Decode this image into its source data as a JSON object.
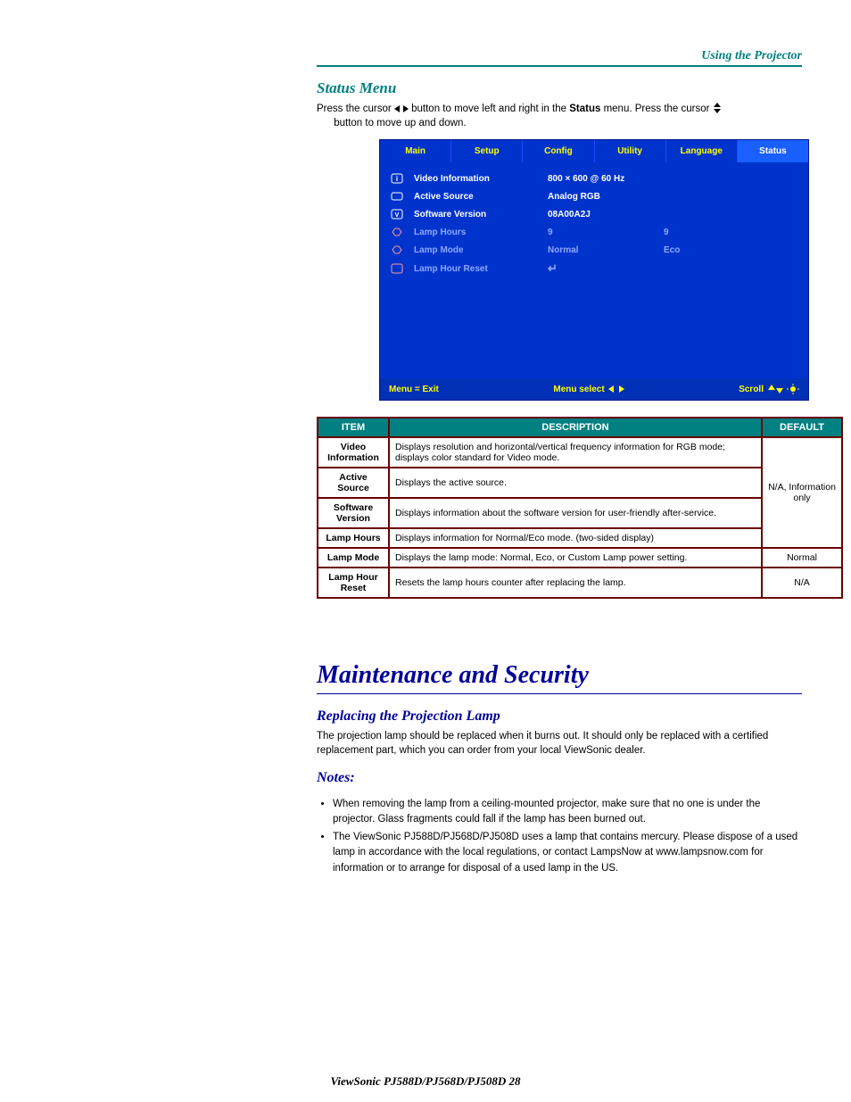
{
  "header_right": "Using the Projector",
  "section_title": "Status Menu",
  "intro_pre": "Press the cursor ",
  "intro_mid": " button to move left and right in the ",
  "intro_post": " button to move up and down.",
  "intro_menu_label": "Status",
  "intro_press": " menu. Press the cursor ",
  "osd": {
    "tabs": [
      "Main",
      "Setup",
      "Config",
      "Utility",
      "Language",
      "Status"
    ],
    "active_tab": "Status",
    "rows": [
      {
        "icon": "info",
        "label": "Video Information",
        "v1": "800 × 600 @ 60 Hz",
        "v2": "",
        "dim": false
      },
      {
        "icon": "source",
        "label": "Active Source",
        "v1": "Analog RGB",
        "v2": "",
        "dim": false
      },
      {
        "icon": "v",
        "label": "Software Version",
        "v1": "08A00A2J",
        "v2": "",
        "dim": false
      },
      {
        "icon": "lamp",
        "label": "Lamp Hours",
        "v1": "9",
        "v2": "9",
        "dim": true
      },
      {
        "icon": "lamp",
        "label": "Lamp Mode",
        "v1": "Normal",
        "v2": "Eco",
        "dim": true
      },
      {
        "icon": "reset",
        "label": "Lamp Hour Reset",
        "v1": "↵",
        "v2": "",
        "dim": true
      }
    ],
    "footer_left": "Menu = Exit",
    "footer_mid": "Menu select",
    "footer_right": "Scroll"
  },
  "table": {
    "headers": [
      "ITEM",
      "DESCRIPTION",
      "DEFAULT"
    ],
    "rows": [
      {
        "item": "Video Information",
        "desc": "Displays resolution and horizontal/vertical frequency information for RGB mode; displays color standard for Video mode.",
        "def_span": true,
        "def": "N/A, Information only"
      },
      {
        "item": "Active Source",
        "desc": "Displays the active source."
      },
      {
        "item": "Software Version",
        "desc": "Displays information about the software version for user-friendly after-service."
      },
      {
        "item": "Lamp Hours",
        "desc": "Displays information for Normal/Eco mode. (two-sided display)"
      },
      {
        "item": "Lamp Mode",
        "desc": "Displays the lamp mode: Normal, Eco, or Custom Lamp power setting.",
        "def": "Normal"
      },
      {
        "item": "Lamp Hour Reset",
        "desc": "Resets the lamp hours counter after replacing the lamp.",
        "def": "N/A"
      }
    ]
  },
  "maint_title": "Maintenance and Security",
  "sub1_title": "Replacing the Projection Lamp",
  "sub1_text": "The projection lamp should be replaced when it burns out. It should only be replaced with a certified replacement part, which you can order from your local ViewSonic dealer.",
  "notes_title": "Notes:",
  "notes": [
    "When removing the lamp from a ceiling-mounted projector, make sure that no one is under the projector. Glass fragments could fall if the lamp has been burned out.",
    "The ViewSonic PJ588D/PJ568D/PJ508D uses a lamp that contains mercury. Please dispose of a used lamp in accordance with the local regulations, or contact LampsNow at www.lampsnow.com for information or to arrange for disposal of a used lamp in the US."
  ],
  "page_footer": "ViewSonic                                                                                       PJ588D/PJ568D/PJ508D                  28"
}
